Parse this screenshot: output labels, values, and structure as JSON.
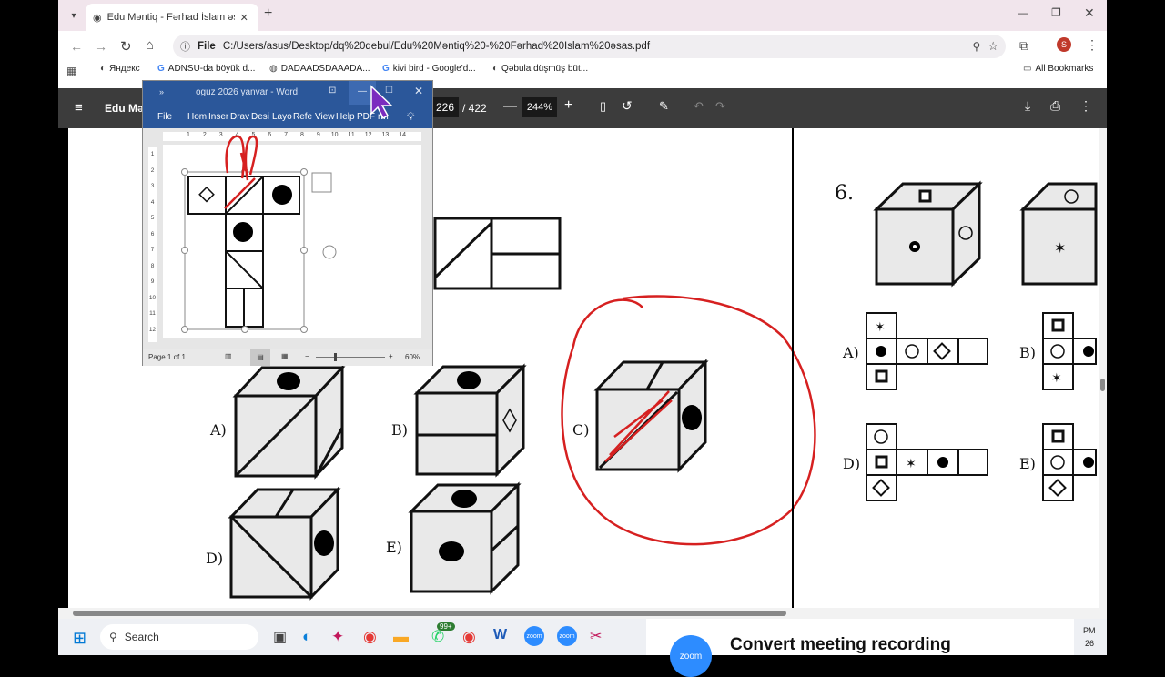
{
  "browser": {
    "tab_title": "Edu Məntiq - Fərhad İslam əsas",
    "address_prefix": "File",
    "url": "C:/Users/asus/Desktop/dq%20qebul/Edu%20Məntiq%20-%20Fərhad%20İslam%20əsas.pdf",
    "bookmarks": [
      "Яндекс",
      "ADNSU-da böyük d...",
      "DADAADSDAAADA...",
      "kivi bird - Google'd...",
      "Qəbula düşmüş büt..."
    ],
    "all_bookmarks": "All Bookmarks"
  },
  "pdf": {
    "title": "Edu Mən",
    "page_current": "226",
    "page_total": "/ 422",
    "zoom": "244%"
  },
  "word": {
    "title": "oguz 2026 yanvar  -  Word",
    "menu": [
      "File",
      "Hom",
      "Inser",
      "Drav",
      "Desi",
      "Layo",
      "Refe",
      "View",
      "Help",
      "PDF",
      "rm"
    ],
    "ruler_numbers": [
      "1",
      "2",
      "3",
      "4",
      "5",
      "6",
      "7",
      "8",
      "9",
      "10",
      "11",
      "12",
      "13",
      "14"
    ],
    "vruler_numbers": [
      "1",
      "2",
      "3",
      "4",
      "5",
      "6",
      "7",
      "8",
      "9",
      "10",
      "11",
      "12"
    ],
    "status_page": "Page 1 of 1",
    "status_zoom": "60%"
  },
  "question": {
    "labels": {
      "a": "A)",
      "b": "B)",
      "c": "C)",
      "d": "D)",
      "e": "E)"
    },
    "q6_number": "6.",
    "q6_labels": {
      "a": "A)",
      "b": "B)",
      "d": "D)",
      "e": "E)"
    }
  },
  "taskbar": {
    "search": "Search",
    "badge": "99+",
    "zoom_notice": "Convert meeting recording",
    "clock_line1": "PM",
    "clock_line2": "26"
  }
}
